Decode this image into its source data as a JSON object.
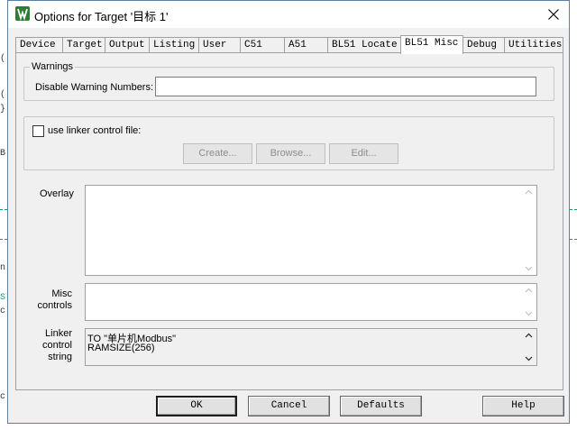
{
  "window": {
    "title": "Options for Target '目标 1'"
  },
  "tabs": [
    "Device",
    "Target",
    "Output",
    "Listing",
    "User",
    "C51",
    "A51",
    "BL51 Locate",
    "BL51 Misc",
    "Debug",
    "Utilities"
  ],
  "active_tab": "BL51 Misc",
  "warnings": {
    "group_label": "Warnings",
    "disable_label": "Disable Warning Numbers:",
    "disable_value": ""
  },
  "linker_control": {
    "checkbox_label": "use linker control file:",
    "checked": false,
    "create_label": "Create...",
    "browse_label": "Browse...",
    "edit_label": "Edit..."
  },
  "overlay": {
    "label": "Overlay",
    "value": ""
  },
  "misc_controls": {
    "label_line1": "Misc",
    "label_line2": "controls",
    "value": ""
  },
  "linker_control_string": {
    "label_line1": "Linker",
    "label_line2": "control",
    "label_line3": "string",
    "lines": [
      "TO \"单片机Modbus\"",
      "RAMSIZE(256)"
    ]
  },
  "buttons": {
    "ok": "OK",
    "cancel": "Cancel",
    "defaults": "Defaults",
    "help": "Help"
  }
}
